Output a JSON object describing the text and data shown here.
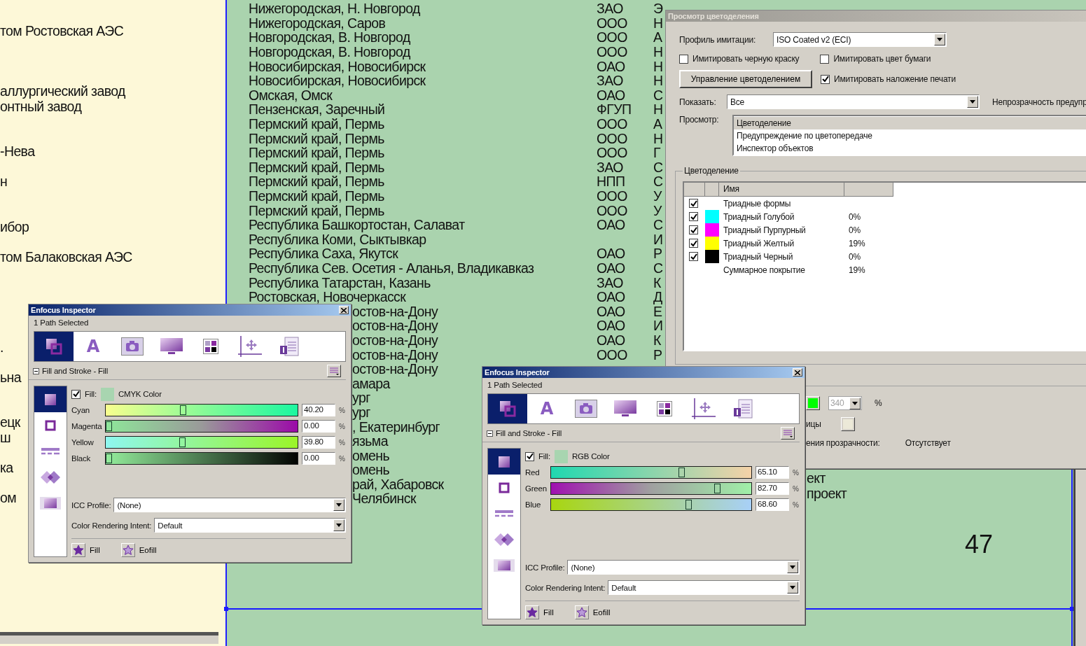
{
  "left_page": {
    "lines": [
      "том Ростовская АЭС",
      "аллургический завод",
      "онтный завод",
      "-Нева",
      "н",
      "ибор",
      "том  Балаковская АЭС",
      ".",
      "ьна",
      "ецк",
      "ш",
      "ка",
      "ом"
    ]
  },
  "document": {
    "rows": [
      {
        "kind": "full",
        "column_1": "Нижегородская, Н. Новгород",
        "column_2": "ЗАО",
        "column_3": "Э"
      },
      {
        "kind": "full",
        "column_1": "Нижегородская, Саров",
        "column_2": "ООО",
        "column_3": "Н"
      },
      {
        "kind": "full",
        "column_1": "Новгородская, В. Новгород",
        "column_2": "ООО",
        "column_3": "А"
      },
      {
        "kind": "full",
        "column_1": "Новгородская, В. Новгород",
        "column_2": "ООО",
        "column_3": "Н"
      },
      {
        "kind": "full",
        "column_1": "Новосибирская, Новосибирск",
        "column_2": "ОАО",
        "column_3": "Н"
      },
      {
        "kind": "full",
        "column_1": "Новосибирская, Новосибирск",
        "column_2": "ЗАО",
        "column_3": "Н"
      },
      {
        "kind": "full",
        "column_1": "Омская, Омск",
        "column_2": "ОАО",
        "column_3": "С"
      },
      {
        "kind": "full",
        "column_1": "Пензенская, Заречный",
        "column_2": "ФГУП",
        "column_3": "Н"
      },
      {
        "kind": "full",
        "column_1": "Пермский край, Пермь",
        "column_2": "ООО",
        "column_3": "А"
      },
      {
        "kind": "full",
        "column_1": "Пермский край, Пермь",
        "column_2": "ООО",
        "column_3": "Н"
      },
      {
        "kind": "full",
        "column_1": "Пермский край, Пермь",
        "column_2": "ООО",
        "column_3": "Г"
      },
      {
        "kind": "full",
        "column_1": "Пермский край, Пермь",
        "column_2": "ЗАО",
        "column_3": "С"
      },
      {
        "kind": "full",
        "column_1": "Пермский край, Пермь",
        "column_2": "НПП",
        "column_3": "С"
      },
      {
        "kind": "full",
        "column_1": "Пермский край, Пермь",
        "column_2": "ООО",
        "column_3": "У"
      },
      {
        "kind": "full",
        "column_1": "Пермский край, Пермь",
        "column_2": "ООО",
        "column_3": "У"
      },
      {
        "kind": "full",
        "column_1": "Республика Башкортостан, Салават",
        "column_2": "ОАО",
        "column_3": "С"
      },
      {
        "kind": "full",
        "column_1": "Республика Коми, Сыктывкар",
        "column_3": "И"
      },
      {
        "kind": "full",
        "column_1": "Республика Саха, Якутск",
        "column_2": "ОАО",
        "column_3": "Р"
      },
      {
        "kind": "full",
        "column_1": "Республика Сев. Осетия - Аланья, Владикавказ",
        "column_2": "ОАО",
        "column_3": "С"
      },
      {
        "kind": "full",
        "column_1": "Республика Татарстан, Казань",
        "column_2": "ЗАО",
        "column_3": "К"
      },
      {
        "kind": "full",
        "column_1": "Ростовская, Новочеркасск",
        "column_2": "ОАО",
        "column_3": "Д"
      },
      {
        "kind": "cut",
        "column_1": "остов-на-Дону",
        "column_2": "ОАО",
        "column_3": "Е"
      },
      {
        "kind": "cut",
        "column_1": "остов-на-Дону",
        "column_2": "ОАО",
        "column_3": "И"
      },
      {
        "kind": "cut",
        "column_1": "остов-на-Дону",
        "column_2": "ОАО",
        "column_3": "К"
      },
      {
        "kind": "cut",
        "column_1": "остов-на-Дону",
        "column_2": "ООО",
        "column_3": "Р"
      },
      {
        "kind": "cut",
        "column_1": "остов-на-Дону"
      },
      {
        "kind": "cut",
        "column_1": "амара"
      },
      {
        "kind": "cut",
        "column_1": "ург"
      },
      {
        "kind": "cut",
        "column_1": "ург"
      },
      {
        "kind": "cut",
        "column_1": ", Екатеринбург"
      },
      {
        "kind": "cut",
        "column_1": "язьма"
      },
      {
        "kind": "cut",
        "column_1": "омень"
      },
      {
        "kind": "cut",
        "column_1": "омень"
      },
      {
        "kind": "cut",
        "column_1": "рай, Хабаровск"
      },
      {
        "kind": "cut",
        "column_1": "Челябинск"
      }
    ]
  },
  "right_page": {
    "lines": [
      "ект",
      "проект"
    ],
    "page_number": "47"
  },
  "separations_dialog": {
    "title": "Просмотр цветоделения",
    "profile": {
      "label": "Профиль имитации:",
      "value": "ISO Coated v2 (ECI)"
    },
    "options": [
      {
        "label": "Имитировать черную краску",
        "checked": false
      },
      {
        "label": "Имитировать цвет бумаги",
        "checked": false
      }
    ],
    "manage_button": "Управление цветоделением",
    "overprint": {
      "label": "Имитировать наложение печати",
      "checked": true
    },
    "show": {
      "label": "Показать:",
      "value": "Все"
    },
    "opacity_label": "Непрозрачность предупр",
    "preview": {
      "label": "Просмотр:",
      "items": [
        {
          "label": "Цветоделение",
          "selected": true
        },
        {
          "label": "Предупреждение по цветопередаче",
          "selected": false
        },
        {
          "label": "Инспектор объектов",
          "selected": false
        }
      ]
    },
    "separations": {
      "title": "Цветоделение",
      "name_column": "Имя",
      "rows": [
        {
          "kind": "group",
          "checked": true,
          "name": "Триадные формы"
        },
        {
          "kind": "plate",
          "checked": true,
          "color": "#00ffff",
          "name": "Триадный Голубой",
          "value": "0%"
        },
        {
          "kind": "plate",
          "checked": true,
          "color": "#ff00ff",
          "name": "Триадный Пурпурный",
          "value": "0%"
        },
        {
          "kind": "plate",
          "checked": true,
          "color": "#ffff00",
          "name": "Триадный Желтый",
          "value": "19%"
        },
        {
          "kind": "plate",
          "checked": true,
          "color": "#000000",
          "name": "Триадный Черный",
          "value": "0%"
        },
        {
          "kind": "total",
          "name": "Суммарное покрытие",
          "value": "19%"
        }
      ]
    },
    "warnings": {
      "limit": {
        "color": "#00ff00",
        "value": "340",
        "unit": "%"
      },
      "page": {
        "label": "ицы",
        "color": "#ece9d8"
      },
      "transparency": {
        "label": "ения прозрачности:",
        "value": "Отсутствует"
      }
    }
  },
  "inspectors": [
    {
      "title": "Enfocus Inspector",
      "status": "1 Path Selected",
      "text_tool": "A",
      "tools": [
        {
          "kind": "fill-stroke",
          "selected": true
        },
        {
          "kind": "text",
          "selected": false
        },
        {
          "kind": "image",
          "selected": false
        },
        {
          "kind": "monitor",
          "selected": false
        },
        {
          "kind": "swatches",
          "selected": false
        },
        {
          "kind": "position",
          "selected": false
        },
        {
          "kind": "document",
          "selected": false
        }
      ],
      "section": "Fill and Stroke - Fill",
      "side_tabs": [
        {
          "kind": "fill",
          "selected": true
        },
        {
          "kind": "stroke",
          "selected": false
        },
        {
          "kind": "dash",
          "selected": false
        },
        {
          "kind": "blend",
          "selected": false
        },
        {
          "kind": "transparency",
          "selected": false
        }
      ],
      "fill": {
        "checked": true,
        "label": "Fill:",
        "color": "#a8d5b0",
        "model": "CMYK Color"
      },
      "channels": [
        {
          "name": "Cyan",
          "level": 0.402,
          "value": "40.20",
          "unit": "%"
        },
        {
          "name": "Magenta",
          "level": 0,
          "value": "0.00",
          "unit": "%"
        },
        {
          "name": "Yellow",
          "level": 0.398,
          "value": "39.80",
          "unit": "%"
        },
        {
          "name": "Black",
          "level": 0,
          "value": "0.00",
          "unit": "%"
        }
      ],
      "icc": {
        "label": "ICC Profile:",
        "value": "(None)"
      },
      "intent": {
        "label": "Color Rendering Intent:",
        "value": "Default"
      },
      "buttons": [
        "Fill",
        "Eofill"
      ]
    },
    {
      "title": "Enfocus Inspector",
      "status": "1 Path Selected",
      "text_tool": "A",
      "tools": [
        {
          "kind": "fill-stroke",
          "selected": true
        },
        {
          "kind": "text",
          "selected": false
        },
        {
          "kind": "image",
          "selected": false
        },
        {
          "kind": "monitor",
          "selected": false
        },
        {
          "kind": "swatches",
          "selected": false
        },
        {
          "kind": "position",
          "selected": false
        },
        {
          "kind": "document",
          "selected": false
        }
      ],
      "section": "Fill and Stroke - Fill",
      "side_tabs": [
        {
          "kind": "fill",
          "selected": true
        },
        {
          "kind": "stroke",
          "selected": false
        },
        {
          "kind": "dash",
          "selected": false
        },
        {
          "kind": "blend",
          "selected": false
        },
        {
          "kind": "transparency",
          "selected": false
        }
      ],
      "fill": {
        "checked": true,
        "label": "Fill:",
        "color": "#a8d5b0",
        "model": "RGB Color"
      },
      "channels": [
        {
          "name": "Red",
          "level": 0.651,
          "value": "65.10",
          "unit": "%"
        },
        {
          "name": "Green",
          "level": 0.827,
          "value": "82.70",
          "unit": "%"
        },
        {
          "name": "Blue",
          "level": 0.686,
          "value": "68.60",
          "unit": "%"
        }
      ],
      "icc": {
        "label": "ICC Profile:",
        "value": "(None)"
      },
      "intent": {
        "label": "Color Rendering Intent:",
        "value": "Default"
      },
      "buttons": [
        "Fill",
        "Eofill"
      ]
    }
  ]
}
